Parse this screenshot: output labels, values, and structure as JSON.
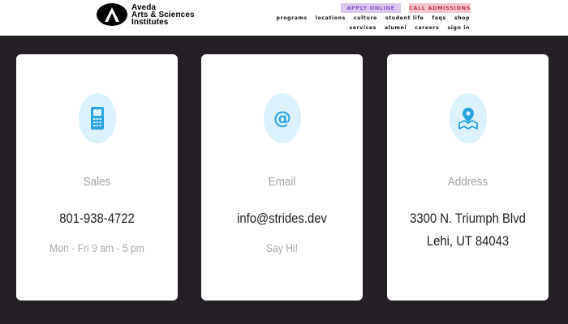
{
  "header": {
    "logo_lines": [
      "Aveda",
      "Arts & Sciences",
      "Institutes"
    ],
    "apply_button": "APPLY ONLINE",
    "call_button": "CALL ADMISSIONS",
    "nav_primary": [
      "programs",
      "locations",
      "culture",
      "student life",
      "faqs",
      "shop"
    ],
    "nav_secondary": [
      "services",
      "alumni",
      "careers",
      "sign in"
    ]
  },
  "cards": [
    {
      "icon": "phone-icon",
      "label": "Sales",
      "value": "801-938-4722",
      "sub": "Mon - Fri 9 am - 5 pm"
    },
    {
      "icon": "at-sign-icon",
      "label": "Email",
      "value": "info@strides.dev",
      "sub": "Say Hi!"
    },
    {
      "icon": "map-pin-icon",
      "label": "Address",
      "value_lines": [
        "3300 N. Triumph Blvd",
        "Lehi, UT 84043"
      ]
    }
  ],
  "colors": {
    "page_bg": "#231f24",
    "icon_bg": "#dbf1fb",
    "icon_fg": "#2aa3e0",
    "apply_bg": "#d9c8ee",
    "call_bg": "#f6c6cf"
  }
}
